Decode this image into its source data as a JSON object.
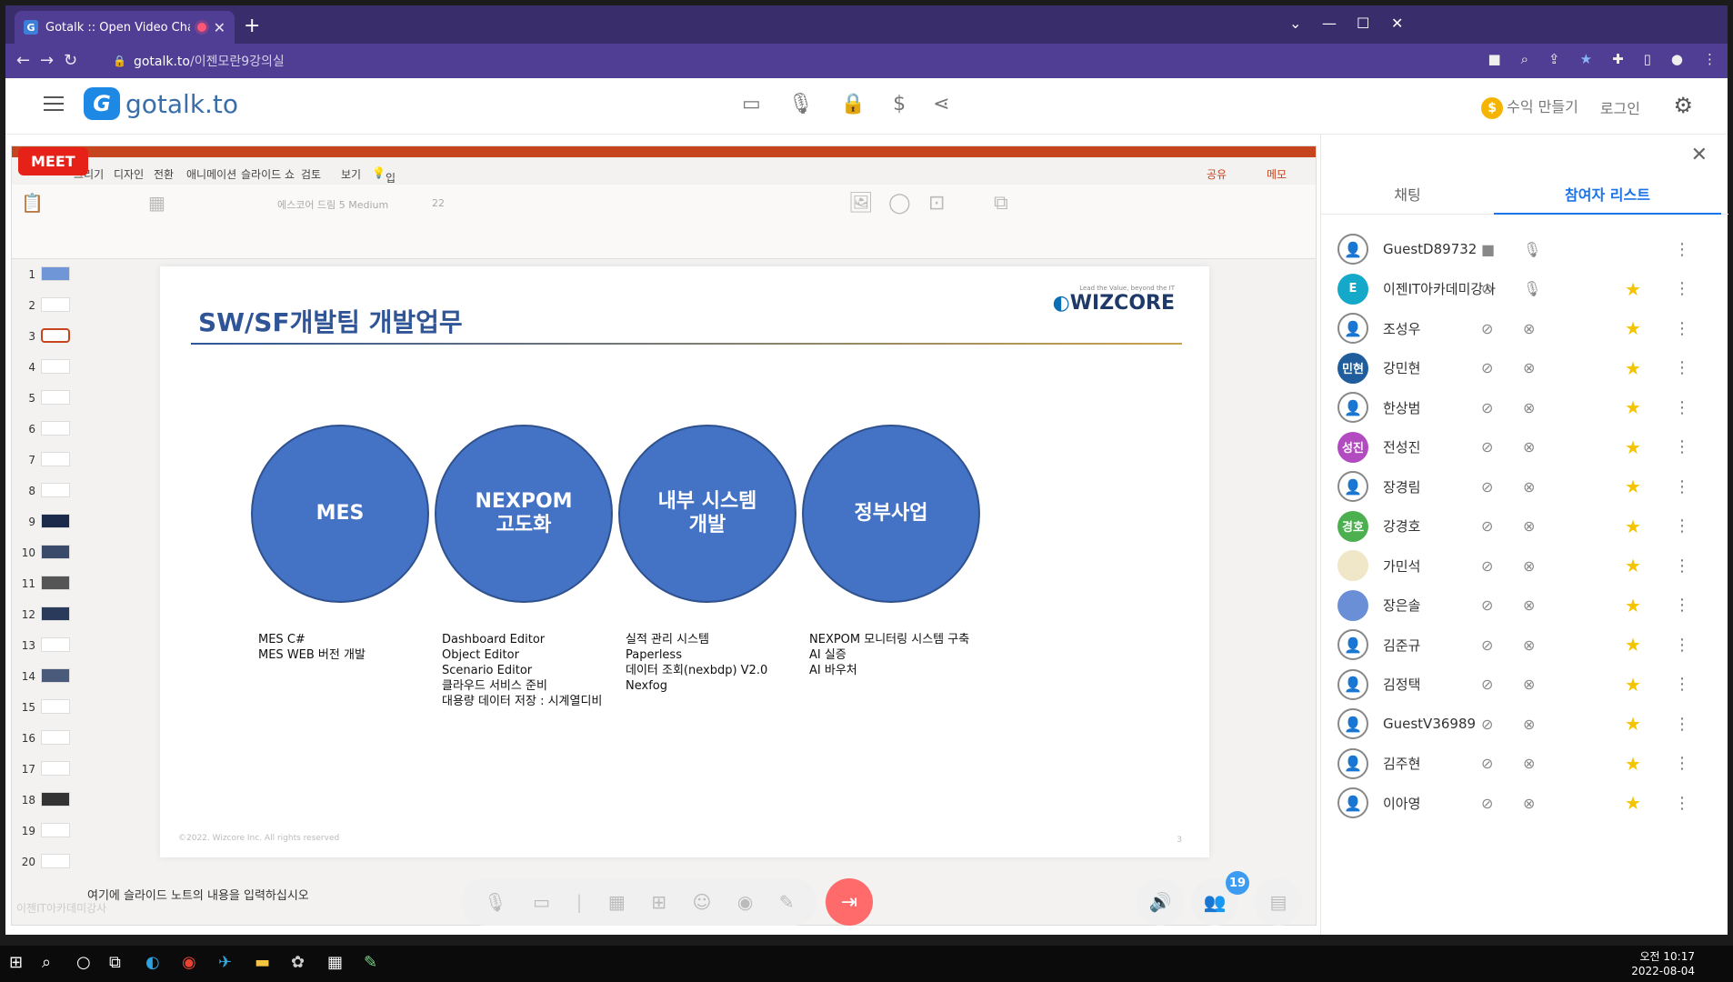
{
  "browser": {
    "tab_title": "Gotalk :: Open Video Chat",
    "url_host": "gotalk.to",
    "url_path": "/이젠모란9강의실"
  },
  "app": {
    "logo_text": "gotalk.to",
    "earn_label": "수익 만들기",
    "login_label": "로그인",
    "meet_badge": "MEET"
  },
  "ppt": {
    "ribbon_tabs": [
      "그리기",
      "디자인",
      "전환",
      "애니메이션",
      "슬라이드 쇼",
      "검토",
      "보기",
      "입력하세요"
    ],
    "share_label": "공유",
    "memo_label": "메모",
    "font_name": "에스코어 드림 5 Medium",
    "font_size": "22",
    "slide_numbers": [
      "1",
      "2",
      "3",
      "4",
      "5",
      "6",
      "7",
      "8",
      "9",
      "10",
      "11",
      "12",
      "13",
      "14",
      "15",
      "16",
      "17",
      "18",
      "19",
      "20"
    ],
    "active_slide": 3,
    "notes_placeholder": "여기에 슬라이드 노트의 내용을 입력하십시오",
    "watermark": "이젠IT아카데미강사"
  },
  "slide": {
    "title": "SW/SF개발팀 개발업무",
    "brand": "WIZCORE",
    "brand_tag": "Lead the Value, beyond the IT",
    "circles": [
      {
        "label": "MES",
        "desc": "MES C#\nMES WEB 버전 개발"
      },
      {
        "label": "NEXPOM\n고도화",
        "desc": "Dashboard Editor\nObject Editor\nScenario Editor\n클라우드 서비스 준비\n대용량 데이터 저장 : 시계열디비"
      },
      {
        "label": "내부 시스템\n개발",
        "desc": "실적 관리 시스템\nPaperless\n데이터 조회(nexbdp) V2.0\nNexfog"
      },
      {
        "label": "정부사업",
        "desc": "NEXPOM 모니터링 시스템 구축\nAI 실증\nAI 바우처"
      }
    ],
    "footer": "©2022. Wizcore Inc. All rights reserved",
    "page_number": "3"
  },
  "controls": {
    "participants_count": "19"
  },
  "panel": {
    "tab_chat": "채팅",
    "tab_participants": "참여자 리스트",
    "participants": [
      {
        "name": "GuestD89732",
        "avatar": "",
        "avatar_color": "",
        "video_on": true,
        "mic_on": true,
        "star": false
      },
      {
        "name": "이젠IT아카데미강사",
        "avatar": "E",
        "avatar_color": "#15a9c9",
        "video_on": false,
        "mic_on": true,
        "star": true
      },
      {
        "name": "조성우",
        "avatar": "",
        "avatar_color": "",
        "video_on": false,
        "mic_on": false,
        "star": true
      },
      {
        "name": "강민현",
        "avatar": "민현",
        "avatar_color": "#1f5d9c",
        "video_on": false,
        "mic_on": false,
        "star": true
      },
      {
        "name": "한상범",
        "avatar": "",
        "avatar_color": "",
        "video_on": false,
        "mic_on": false,
        "star": true
      },
      {
        "name": "전성진",
        "avatar": "성진",
        "avatar_color": "#b24ac0",
        "video_on": false,
        "mic_on": false,
        "star": true
      },
      {
        "name": "장경림",
        "avatar": "",
        "avatar_color": "",
        "video_on": false,
        "mic_on": false,
        "star": true
      },
      {
        "name": "강경호",
        "avatar": "경호",
        "avatar_color": "#4caf50",
        "video_on": false,
        "mic_on": false,
        "star": true
      },
      {
        "name": "가민석",
        "avatar": "",
        "avatar_color": "#f0e6c8",
        "video_on": false,
        "mic_on": false,
        "star": true
      },
      {
        "name": "장은솔",
        "avatar": "",
        "avatar_color": "#6a8fd6",
        "video_on": false,
        "mic_on": false,
        "star": true
      },
      {
        "name": "김준규",
        "avatar": "",
        "avatar_color": "",
        "video_on": false,
        "mic_on": false,
        "star": true
      },
      {
        "name": "김정택",
        "avatar": "",
        "avatar_color": "",
        "video_on": false,
        "mic_on": false,
        "star": true
      },
      {
        "name": "GuestV36989",
        "avatar": "",
        "avatar_color": "",
        "video_on": false,
        "mic_on": false,
        "star": true
      },
      {
        "name": "김주현",
        "avatar": "",
        "avatar_color": "",
        "video_on": false,
        "mic_on": false,
        "star": true
      },
      {
        "name": "이아영",
        "avatar": "",
        "avatar_color": "",
        "video_on": false,
        "mic_on": false,
        "star": true
      }
    ]
  },
  "taskbar": {
    "time": "오전 10:17",
    "date": "2022-08-04"
  }
}
